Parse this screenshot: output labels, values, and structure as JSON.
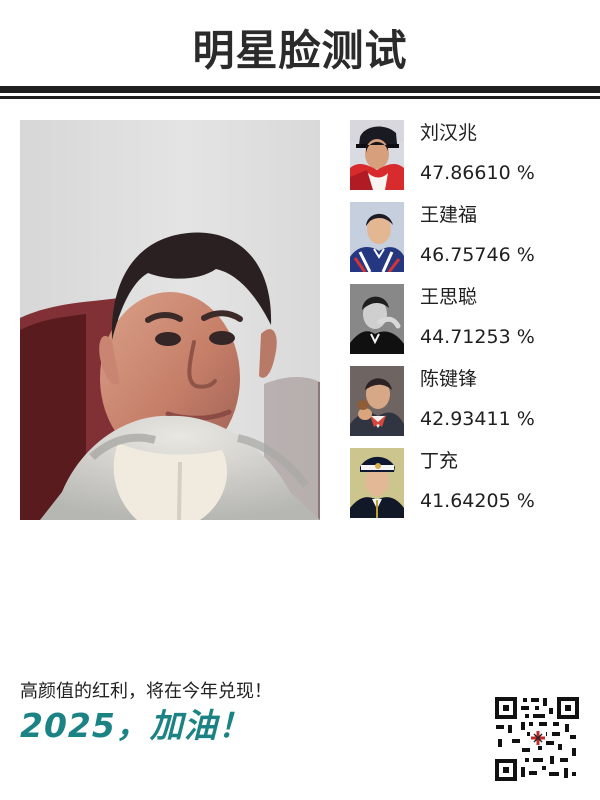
{
  "header": {
    "title": "明星脸测试"
  },
  "main": {
    "photo": {
      "name": "main-face-photo"
    }
  },
  "results": {
    "items": [
      {
        "name": "刘汉兆",
        "score": "47.86610 %"
      },
      {
        "name": "王建福",
        "score": "46.75746 %"
      },
      {
        "name": "王思聪",
        "score": "44.71253 %"
      },
      {
        "name": "陈键锋",
        "score": "42.93411 %"
      },
      {
        "name": "丁充",
        "score": "41.64205 %"
      }
    ]
  },
  "footer": {
    "slogan": "高颜值的红利，将在今年兑现！",
    "big_slogan": "2025，加油！"
  },
  "colors": {
    "accent": "#1c8385",
    "rule": "#1f1f1f",
    "background": "#ffffff"
  }
}
